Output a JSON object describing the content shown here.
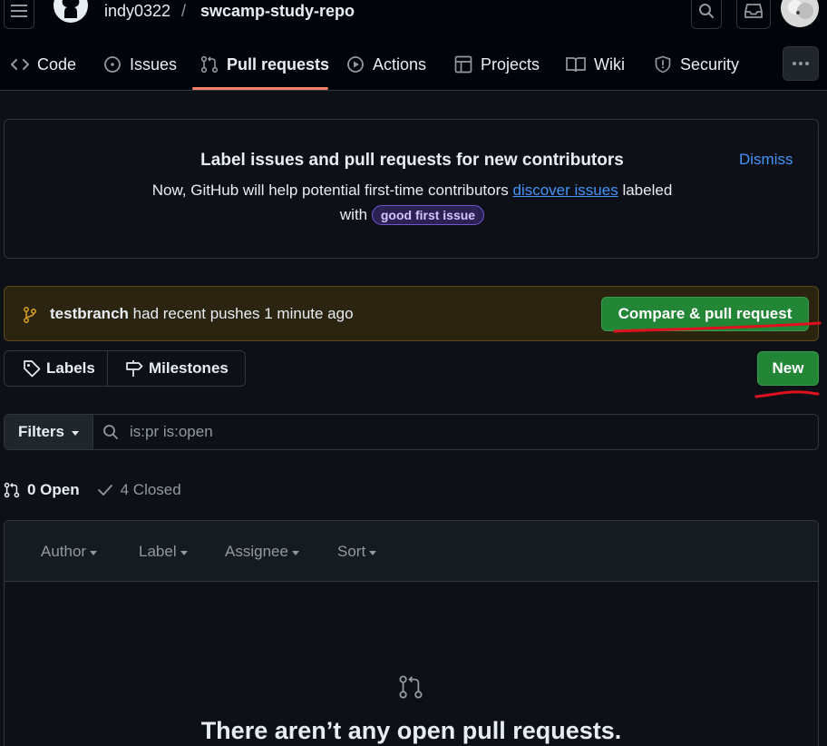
{
  "header": {
    "owner": "indy0322",
    "separator": "/",
    "repo": "swcamp-study-repo"
  },
  "tabs": [
    {
      "label": "Code",
      "icon": "code-icon"
    },
    {
      "label": "Issues",
      "icon": "issue-opened-icon"
    },
    {
      "label": "Pull requests",
      "icon": "git-pull-request-icon",
      "selected": true
    },
    {
      "label": "Actions",
      "icon": "play-icon"
    },
    {
      "label": "Projects",
      "icon": "table-icon"
    },
    {
      "label": "Wiki",
      "icon": "book-icon"
    },
    {
      "label": "Security",
      "icon": "shield-icon"
    }
  ],
  "banner": {
    "title": "Label issues and pull requests for new contributors",
    "line1_prefix": "Now, GitHub will help potential first-time contributors",
    "link": "discover issues",
    "line1_suffix": "labeled",
    "line2_prefix": "with",
    "label": "good first issue",
    "dismiss": "Dismiss"
  },
  "recent_push": {
    "branch": "testbranch",
    "text": "had recent pushes 1 minute ago",
    "button": "Compare & pull request"
  },
  "toolbar": {
    "labels": "Labels",
    "milestones": "Milestones",
    "new": "New"
  },
  "filters": {
    "button": "Filters",
    "query": "is:pr is:open"
  },
  "states": {
    "open": "0 Open",
    "closed": "4 Closed"
  },
  "list_header": {
    "author": "Author",
    "label": "Label",
    "assignee": "Assignee",
    "sort": "Sort"
  },
  "empty": {
    "title": "There aren’t any open pull requests."
  },
  "colors": {
    "background": "#0d1117",
    "accent_green": "#238636",
    "link_blue": "#4493f8",
    "tab_underline": "#f78166",
    "annotation_red": "#e0101e"
  }
}
